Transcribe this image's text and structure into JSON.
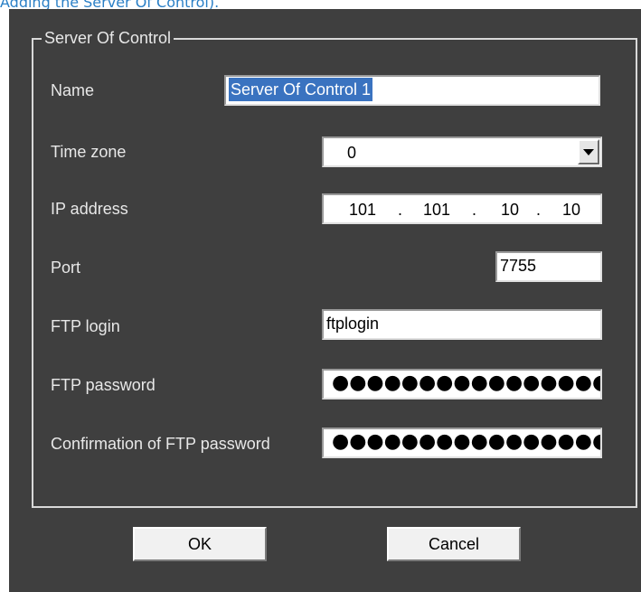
{
  "caption": "Adding the Server Of Control).",
  "dialog": {
    "group_title": "Server Of Control",
    "fields": {
      "name": {
        "label": "Name",
        "value": "Server Of Control 1"
      },
      "time_zone": {
        "label": "Time zone",
        "value": "0"
      },
      "ip_address": {
        "label": "IP address",
        "octets": [
          "101",
          "101",
          "10",
          "10"
        ],
        "separator": "."
      },
      "port": {
        "label": "Port",
        "value": "7755"
      },
      "ftp_login": {
        "label": "FTP login",
        "value": "ftplogin"
      },
      "ftp_password": {
        "label": "FTP password",
        "masked_value": "●●●●●●●●●●●●●●●●"
      },
      "ftp_password_confirm": {
        "label": "Confirmation of FTP password",
        "masked_value": "●●●●●●●●●●●●●●●●"
      }
    },
    "buttons": {
      "ok": "OK",
      "cancel": "Cancel"
    }
  },
  "icons": {
    "dropdown_arrow": "chevron-down-icon"
  },
  "colors": {
    "dialog_bg": "#3f3f3f",
    "selection": "#3a73c0",
    "caption_link": "#2a7fc6"
  }
}
